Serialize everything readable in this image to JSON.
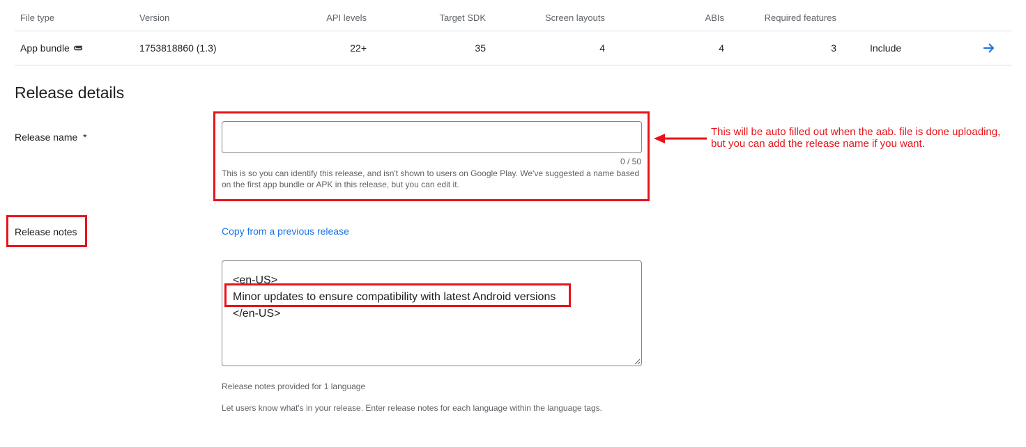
{
  "table": {
    "headers": {
      "file_type": "File type",
      "version": "Version",
      "api_levels": "API levels",
      "target_sdk": "Target SDK",
      "screen_layouts": "Screen layouts",
      "abis": "ABIs",
      "required_features": "Required features"
    },
    "row": {
      "file_type": "App bundle",
      "version": "1753818860 (1.3)",
      "api_levels": "22+",
      "target_sdk": "35",
      "screen_layouts": "4",
      "abis": "4",
      "required_features": "3",
      "action": "Include"
    }
  },
  "release_details": {
    "title": "Release details",
    "release_name_label": "Release name",
    "required_mark": "*",
    "release_name_value": "",
    "counter": "0 / 50",
    "helper": "This is so you can identify this release, and isn't shown to users on Google Play. We've suggested a name based on the first app bundle or APK in this release, but you can edit it.",
    "release_notes_label": "Release notes",
    "copy_link": "Copy from a previous release",
    "notes_lines": [
      "<en-US>",
      "Minor updates to ensure compatibility with latest Android versions",
      "</en-US>"
    ],
    "notes_language_count": "Release notes provided for 1 language",
    "notes_instructions": "Let users know what's in your release. Enter release notes for each language within the language tags."
  },
  "annotation": {
    "text": "This will be auto filled out when the aab. file is done uploading, but you can add the release name if you want.",
    "color": "#e8131a"
  },
  "colors": {
    "link": "#1a73e8",
    "divider": "#dadce0",
    "muted": "#5f6368"
  },
  "icons": {
    "file_type": "paperclip-icon",
    "row_action": "arrow-right-icon"
  }
}
